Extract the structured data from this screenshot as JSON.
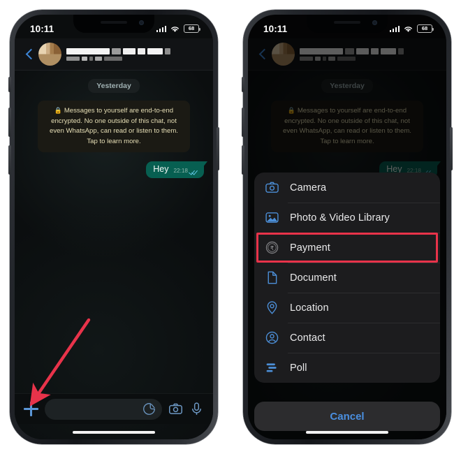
{
  "accent": {
    "whatsapp_green": "#075f51",
    "ios_blue": "#4a8fe0",
    "icon_blue": "#5b96d6",
    "highlight_red": "#e8334a",
    "encryption_yellow": "#e7dfb6"
  },
  "phones": {
    "left": {
      "status_bar": {
        "time": "10:11",
        "battery_level": "68",
        "signal_icon": "cellular-signal-icon",
        "wifi_icon": "wifi-icon",
        "battery_icon": "battery-icon"
      },
      "header": {
        "back_icon": "back-chevron-icon",
        "avatar": "contact-avatar-redacted",
        "contact_name": "",
        "contact_status": ""
      },
      "chat": {
        "day_separator": "Yesterday",
        "encryption_notice": "Messages to yourself are end-to-end encrypted. No one outside of this chat, not even WhatsApp, can read or listen to them. Tap to learn more.",
        "lock_icon": "lock-icon",
        "messages": [
          {
            "text": "Hey",
            "time": "22:18",
            "status_icon": "read-ticks-icon",
            "direction": "outgoing"
          }
        ]
      },
      "input_bar": {
        "plus_icon": "plus-icon",
        "message_placeholder": "",
        "sticker_icon": "sticker-icon",
        "camera_icon": "camera-icon",
        "mic_icon": "microphone-icon"
      },
      "annotation": {
        "arrow_icon": "red-arrow-pointing-to-plus-button",
        "arrow_color": "#e8334a"
      }
    },
    "right": {
      "status_bar": {
        "time": "10:11",
        "battery_level": "68",
        "signal_icon": "cellular-signal-icon",
        "wifi_icon": "wifi-icon",
        "battery_icon": "battery-icon"
      },
      "header": {
        "back_icon": "back-chevron-icon",
        "avatar": "contact-avatar-redacted",
        "contact_name": "",
        "contact_status": ""
      },
      "chat": {
        "day_separator": "Yesterday",
        "encryption_notice": "Messages to yourself are end-to-end encrypted. No one outside of this chat, not even WhatsApp, can read or listen to them. Tap to learn more.",
        "lock_icon": "lock-icon",
        "messages": [
          {
            "text": "Hey",
            "time": "22:18",
            "status_icon": "read-ticks-icon",
            "direction": "outgoing"
          }
        ]
      },
      "attach_sheet": {
        "items": [
          {
            "label": "Camera",
            "icon": "camera-icon",
            "highlighted": false
          },
          {
            "label": "Photo & Video Library",
            "icon": "photos-icon",
            "highlighted": true
          },
          {
            "label": "Payment",
            "icon": "rupee-payment-icon",
            "highlighted": false
          },
          {
            "label": "Document",
            "icon": "document-icon",
            "highlighted": false
          },
          {
            "label": "Location",
            "icon": "location-pin-icon",
            "highlighted": false
          },
          {
            "label": "Contact",
            "icon": "contact-person-icon",
            "highlighted": false
          },
          {
            "label": "Poll",
            "icon": "poll-bars-icon",
            "highlighted": false
          }
        ],
        "cancel_label": "Cancel"
      }
    }
  }
}
